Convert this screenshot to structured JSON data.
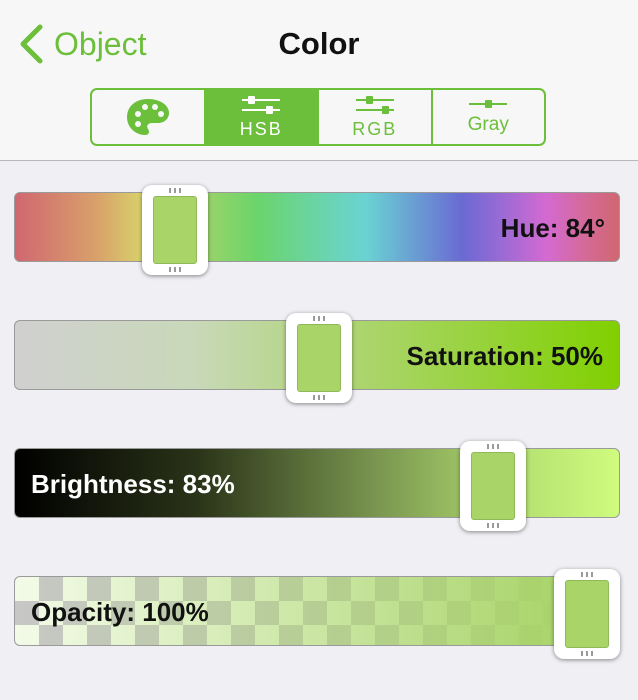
{
  "nav": {
    "back_label": "Object",
    "title": "Color"
  },
  "segments": [
    {
      "label": "",
      "icon": "palette-icon",
      "active": false
    },
    {
      "label": "HSB",
      "icon": "hsb-sliders-icon",
      "active": true
    },
    {
      "label": "RGB",
      "icon": "rgb-sliders-icon",
      "active": false
    },
    {
      "label": "Gray",
      "icon": "gray-slider-icon",
      "active": false
    }
  ],
  "sliders": {
    "hue": {
      "label": "Hue: 84°",
      "value": 84,
      "max": 360
    },
    "saturation": {
      "label": "Saturation: 50%",
      "value": 0.5
    },
    "brightness": {
      "label": "Brightness: 83%",
      "value": 0.83
    },
    "opacity": {
      "label": "Opacity: 100%",
      "value": 1.0
    }
  },
  "colors": {
    "accent": "#6bbf3a",
    "current_color": "#a8d468"
  }
}
